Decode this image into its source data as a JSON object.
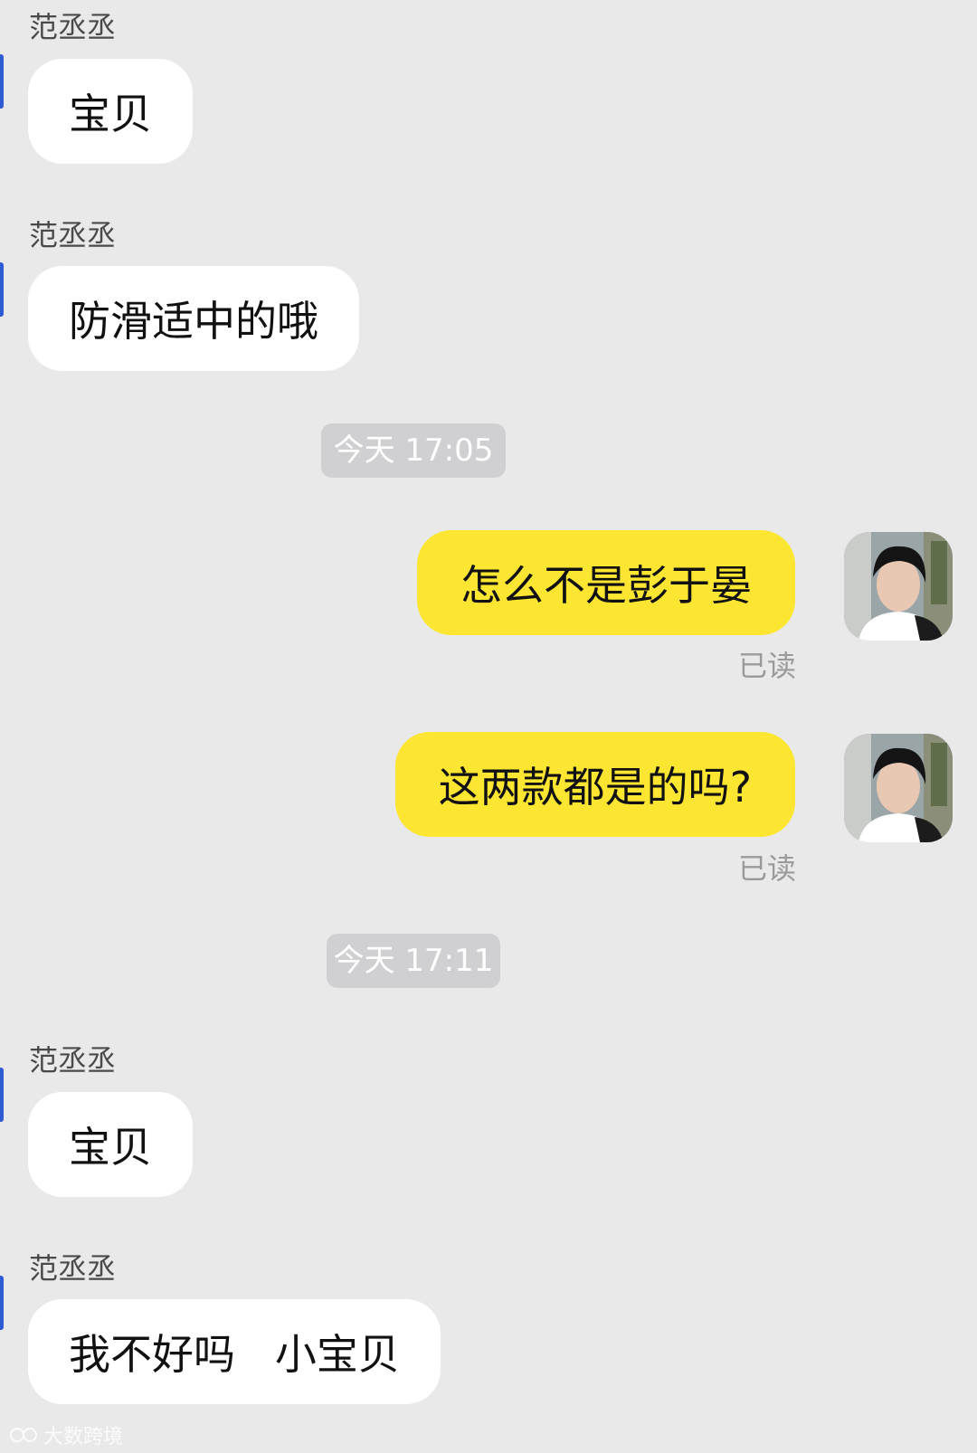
{
  "messages": [
    {
      "sender": "范丞丞",
      "text": "宝贝"
    },
    {
      "sender": "范丞丞",
      "text": "防滑适中的哦"
    },
    {
      "time": "今天 17:05"
    },
    {
      "text": "怎么不是彭于晏",
      "status": "已读"
    },
    {
      "text": "这两款都是的吗?",
      "status": "已读"
    },
    {
      "time": "今天 17:11"
    },
    {
      "sender": "范丞丞",
      "text": "宝贝"
    },
    {
      "sender": "范丞丞",
      "text": "我不好吗   小宝贝"
    }
  ],
  "watermark": "大数跨境",
  "colors": {
    "background": "#e9e9ea",
    "incoming_bubble": "#ffffff",
    "outgoing_bubble": "#fde631",
    "time_chip": "#d0d0d3",
    "read_status": "#9a9a9a"
  }
}
